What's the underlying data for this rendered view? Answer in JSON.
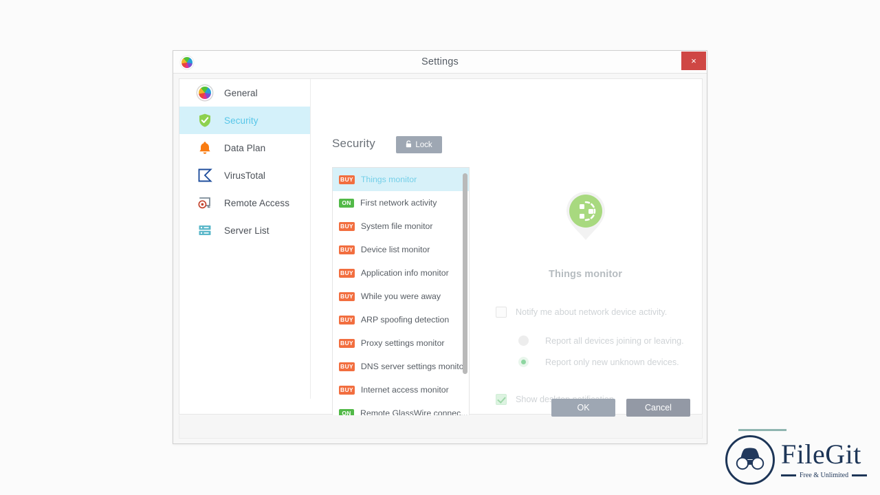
{
  "window": {
    "title": "Settings",
    "app_icon": "glasswire-logo-icon",
    "close_label": "×"
  },
  "sidebar": {
    "items": [
      {
        "label": "General",
        "icon": "color-wheel-icon",
        "active": false
      },
      {
        "label": "Security",
        "icon": "shield-check-icon",
        "active": true
      },
      {
        "label": "Data Plan",
        "icon": "bell-icon",
        "active": false
      },
      {
        "label": "VirusTotal",
        "icon": "sigma-icon",
        "active": false
      },
      {
        "label": "Remote Access",
        "icon": "remote-eye-icon",
        "active": false
      },
      {
        "label": "Server List",
        "icon": "server-icon",
        "active": false
      }
    ]
  },
  "content": {
    "page_title": "Security",
    "lock_button": {
      "label": "Lock",
      "icon": "lock-icon"
    },
    "feature_list": [
      {
        "badge": "BUY",
        "badge_type": "buy",
        "label": "Things monitor",
        "selected": true
      },
      {
        "badge": "ON",
        "badge_type": "on",
        "label": "First network activity",
        "selected": false
      },
      {
        "badge": "BUY",
        "badge_type": "buy",
        "label": "System file monitor",
        "selected": false
      },
      {
        "badge": "BUY",
        "badge_type": "buy",
        "label": "Device list monitor",
        "selected": false
      },
      {
        "badge": "BUY",
        "badge_type": "buy",
        "label": "Application info monitor",
        "selected": false
      },
      {
        "badge": "BUY",
        "badge_type": "buy",
        "label": "While you were away",
        "selected": false
      },
      {
        "badge": "BUY",
        "badge_type": "buy",
        "label": "ARP spoofing detection",
        "selected": false
      },
      {
        "badge": "BUY",
        "badge_type": "buy",
        "label": "Proxy settings monitor",
        "selected": false
      },
      {
        "badge": "BUY",
        "badge_type": "buy",
        "label": "DNS server settings monitor",
        "selected": false
      },
      {
        "badge": "BUY",
        "badge_type": "buy",
        "label": "Internet access monitor",
        "selected": false
      },
      {
        "badge": "ON",
        "badge_type": "on",
        "label": "Remote GlassWire connec...",
        "selected": false
      }
    ],
    "detail": {
      "icon": "things-monitor-pin-icon",
      "title": "Things monitor",
      "notify_checkbox": {
        "label": "Notify me about network device activity.",
        "checked": false
      },
      "radio_options": [
        {
          "label": "Report all devices joining or leaving.",
          "selected": false
        },
        {
          "label": "Report only new unknown devices.",
          "selected": true
        }
      ],
      "desktop_checkbox": {
        "label": "Show desktop notification.",
        "checked": true
      }
    }
  },
  "footer": {
    "ok_label": "OK",
    "cancel_label": "Cancel"
  },
  "watermark": {
    "name": "FileGit",
    "tagline": "Free & Unlimited"
  },
  "colors": {
    "accent_blue": "#57c6e8",
    "highlight_row": "#d7f1f9",
    "badge_buy": "#f26e3f",
    "badge_on": "#52b948",
    "button_grey": "#9ea7b3",
    "close_red": "#cf4744",
    "logo_navy": "#1d3557"
  }
}
